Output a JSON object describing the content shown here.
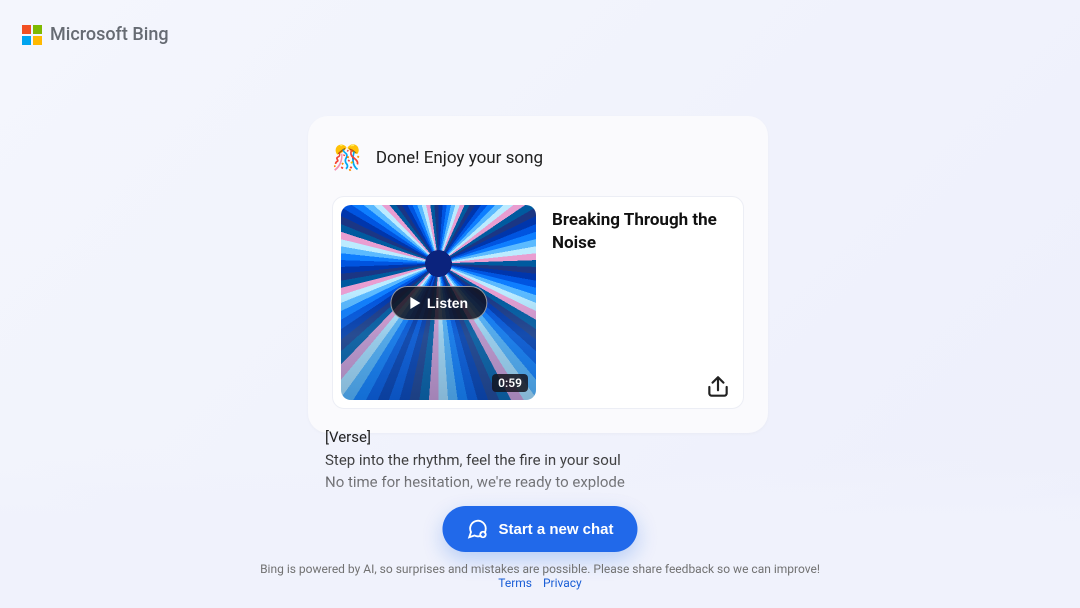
{
  "brand": {
    "label": "Microsoft Bing"
  },
  "card": {
    "status": "Done! Enjoy your song",
    "confetti_icon": "🎊",
    "listen_label": "Listen",
    "duration": "0:59",
    "song_title": "Breaking Through the Noise"
  },
  "lyrics": {
    "section_label": "[Verse]",
    "line1": "Step into the rhythm, feel the fire in your soul",
    "line2": "No time for hesitation, we're ready to explode"
  },
  "actions": {
    "new_chat_label": "Start a new chat"
  },
  "footer": {
    "disclaimer": "Bing is powered by AI, so surprises and mistakes are possible. Please share feedback so we can improve!",
    "terms_label": "Terms",
    "privacy_label": "Privacy"
  }
}
